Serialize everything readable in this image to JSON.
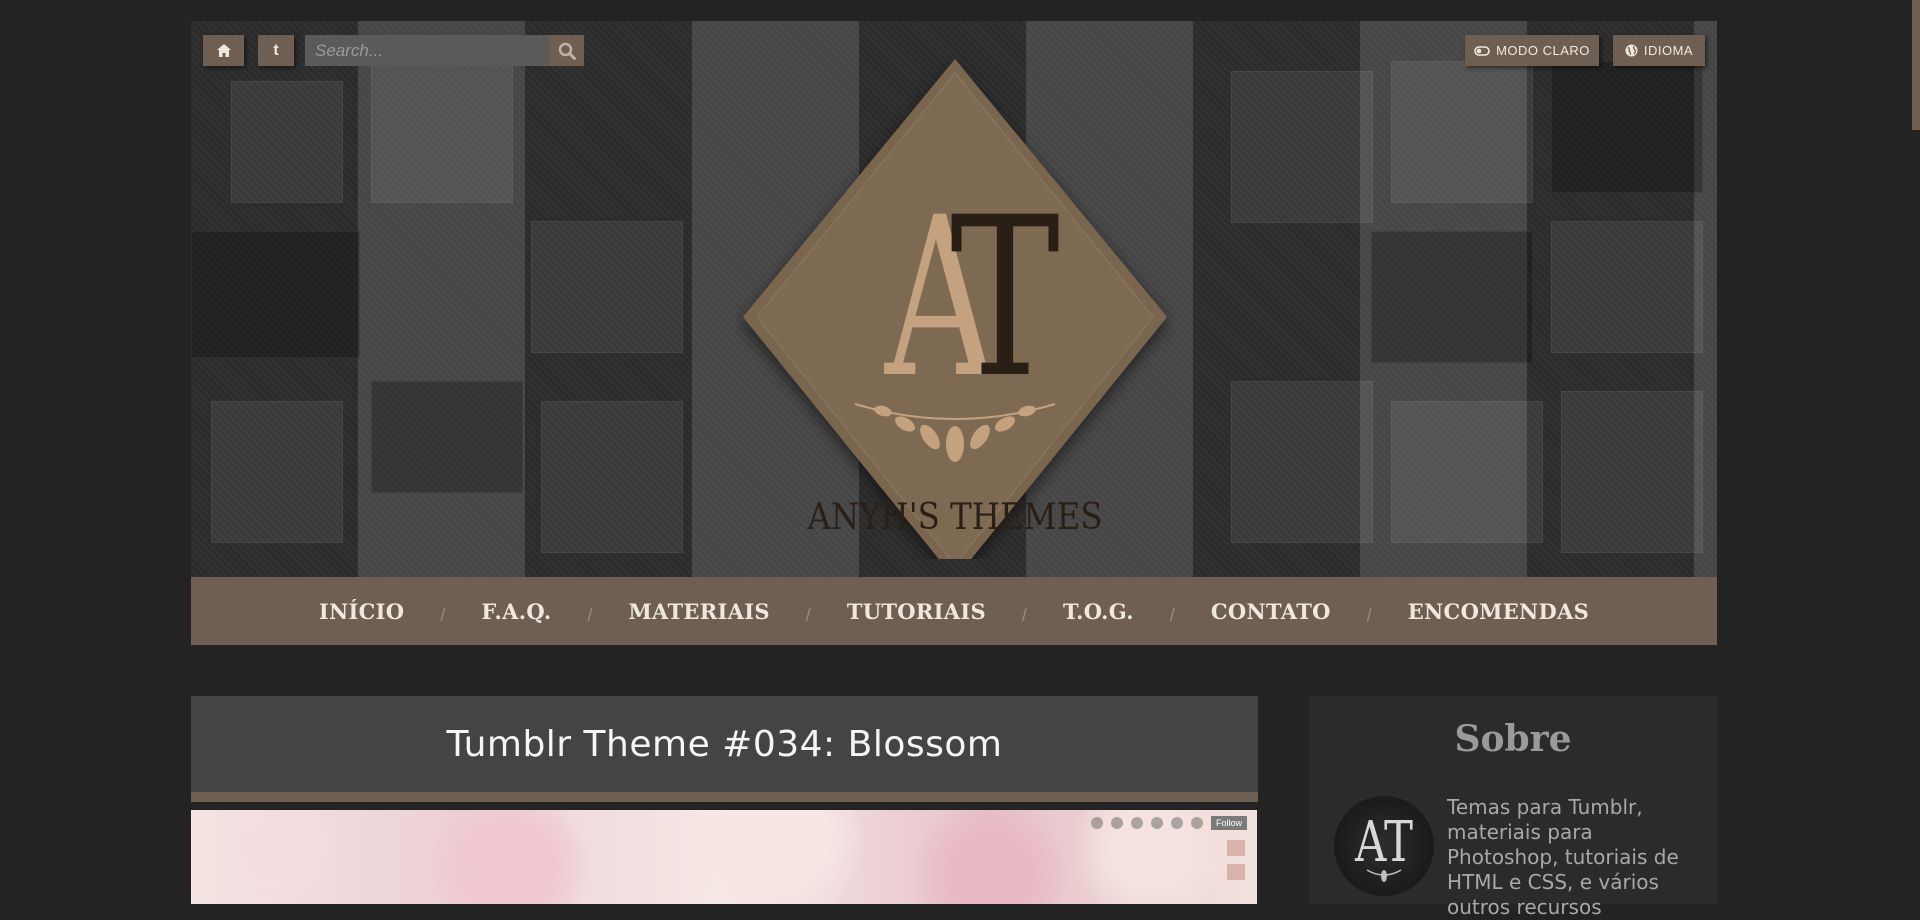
{
  "header": {
    "search": {
      "placeholder": "Search..."
    },
    "tumblr_label": "t",
    "modo_claro_label": "MODO CLARO",
    "idioma_label": "IDIOMA",
    "logo": {
      "monogram": "AT",
      "wordmark": "ANYH'S THEMES"
    }
  },
  "nav": {
    "items": [
      {
        "label": "INÍCIO"
      },
      {
        "label": "F.A.Q."
      },
      {
        "label": "MATERIAIS"
      },
      {
        "label": "TUTORIAIS"
      },
      {
        "label": "T.O.G."
      },
      {
        "label": "CONTATO"
      },
      {
        "label": "ENCOMENDAS"
      }
    ],
    "separator": "/"
  },
  "post": {
    "title": "Tumblr Theme #034: Blossom",
    "preview_follow_label": "Follow"
  },
  "sidebar": {
    "title": "Sobre",
    "avatar_monogram": "AT",
    "text": "Temas para Tumblr, materiais para Photoshop, tutoriais de HTML e CSS, e vários outros recursos"
  },
  "colors": {
    "page_background": "#232323",
    "accent": "#6e5f52",
    "post_title_bg": "#444444",
    "sidebar_bg": "#2b2b2b",
    "nav_text": "#f0e8df"
  },
  "icons": [
    "home-icon",
    "tumblr-icon",
    "search-icon",
    "toggle-icon",
    "globe-icon"
  ]
}
